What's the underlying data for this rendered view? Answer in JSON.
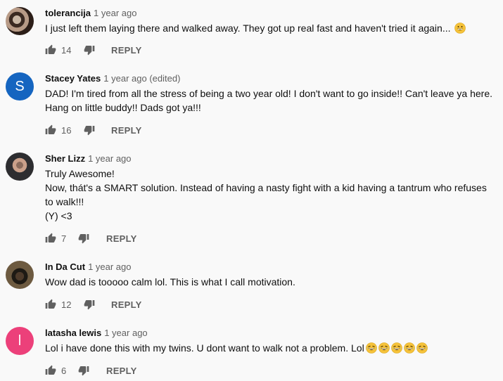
{
  "comments": [
    {
      "author": "tolerancija",
      "time": "1 year ago",
      "avatar_type": "photo",
      "lines": [
        "I just left them laying there and walked away. They got up real fast and haven't tried it again... "
      ],
      "emoji_count": 1,
      "likes": "14",
      "reply": "REPLY"
    },
    {
      "author": "Stacey Yates",
      "time": "1 year ago (edited)",
      "avatar_type": "letter",
      "avatar_letter": "S",
      "avatar_color": "#1565c0",
      "lines": [
        "DAD! I'm tired from all the stress of being a two year old! I don't want to go inside!! Can't leave ya here.",
        "Hang on little buddy!! Dads got ya!!!"
      ],
      "emoji_count": 0,
      "likes": "16",
      "reply": "REPLY"
    },
    {
      "author": "Sher Lizz",
      "time": "1 year ago",
      "avatar_type": "photo",
      "lines": [
        "Truly Awesome!",
        "Now, thát's a SMART solution. Instead of having a nasty fight with a kid having a tantrum who refuses",
        "to walk!!!",
        "(Y) <3"
      ],
      "emoji_count": 0,
      "likes": "7",
      "reply": "REPLY"
    },
    {
      "author": "In Da Cut",
      "time": "1 year ago",
      "avatar_type": "photo",
      "lines": [
        "Wow dad is tooooo calm lol. This is what I call motivation."
      ],
      "emoji_count": 0,
      "likes": "12",
      "reply": "REPLY"
    },
    {
      "author": "latasha lewis",
      "time": "1 year ago",
      "avatar_type": "letter",
      "avatar_letter": "l",
      "avatar_color": "#ec407a",
      "lines": [
        "Lol i have done this with my twins. U dont want to walk not a problem. Lol"
      ],
      "emoji_count": 5,
      "likes": "6",
      "reply": "REPLY"
    }
  ],
  "colors": {
    "emoji_face": "#f5c23a",
    "icon": "#606060"
  },
  "icons": {
    "like": "thumb-up-icon",
    "dislike": "thumb-down-icon",
    "emoji": "grinning-face-emoji"
  }
}
